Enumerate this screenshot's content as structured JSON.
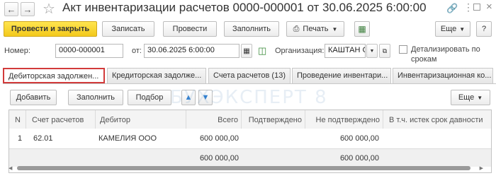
{
  "window": {
    "title": "Акт инвентаризации расчетов 0000-000001 от 30.06.2025 6:00:00"
  },
  "toolbar": {
    "post_close_label": "Провести и закрыть",
    "save_label": "Записать",
    "post_label": "Провести",
    "fill_label": "Заполнить",
    "print_label": "Печать",
    "more_label": "Еще",
    "help_label": "?"
  },
  "form": {
    "number_label": "Номер:",
    "number_value": "0000-000001",
    "date_label": "от:",
    "date_value": "30.06.2025  6:00:00",
    "org_label": "Организация:",
    "org_value": "КАШТАН С",
    "detail_label_1": "Детализировать по",
    "detail_label_2": "срокам"
  },
  "tabs": [
    {
      "label": "Дебиторская задолжен..."
    },
    {
      "label": "Кредиторская задолже..."
    },
    {
      "label": "Счета расчетов (13)"
    },
    {
      "label": "Проведение инвентари..."
    },
    {
      "label": "Инвентаризационная ко..."
    }
  ],
  "table_toolbar": {
    "add_label": "Добавить",
    "fill_label": "Заполнить",
    "select_label": "Подбор",
    "more_label": "Еще"
  },
  "watermark": "БУХЭКСПЕРТ 8",
  "table": {
    "columns": [
      "N",
      "Счет расчетов",
      "Дебитор",
      "Всего",
      "Подтверждено",
      "Не подтверждено",
      "В т.ч. истек срок давности"
    ],
    "rows": [
      {
        "n": "1",
        "account": "62.01",
        "debtor": "КАМЕЛИЯ ООО",
        "total": "600 000,00",
        "confirmed": "",
        "unconfirmed": "600 000,00",
        "expired": ""
      }
    ],
    "footer": {
      "total": "600 000,00",
      "unconfirmed": "600 000,00"
    }
  }
}
